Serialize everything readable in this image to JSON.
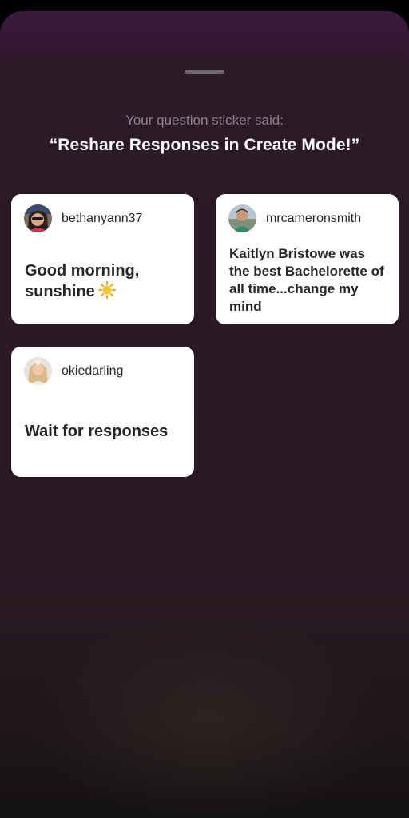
{
  "sheet": {
    "subtitle": "Your question sticker said:",
    "question": "“Reshare Responses in Create Mode!”"
  },
  "responses": [
    {
      "username": "bethanyann37",
      "answer": "Good morning, sunshine",
      "emoji_icon": "sun-emoji-icon"
    },
    {
      "username": "mrcameronsmith",
      "answer": "Kaitlyn Bristowe was the best Bachelorette of all time...change my mind"
    },
    {
      "username": "okiedarling",
      "answer": "Wait for responses"
    }
  ],
  "colors": {
    "sheet_background": "#2a1a25",
    "card_background": "#ffffff",
    "text_dark": "#262626",
    "subtitle_gray": "#8a8090",
    "grabber": "#6d6570"
  }
}
